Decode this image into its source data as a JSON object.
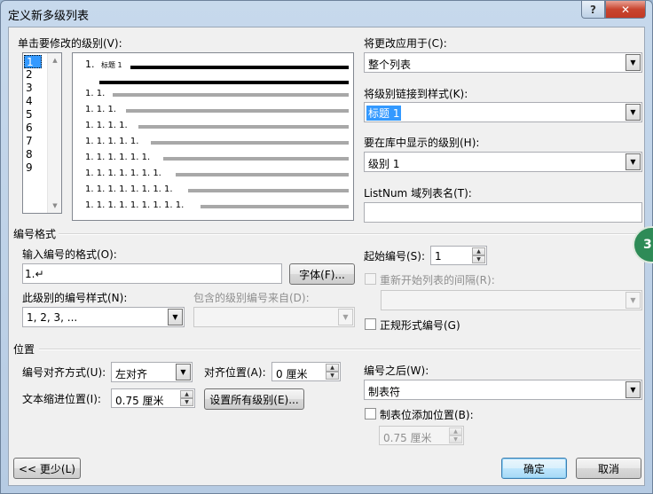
{
  "window": {
    "title": "定义新多级列表",
    "help_glyph": "?",
    "close_glyph": "✕"
  },
  "levels": {
    "label": "单击要修改的级别(V):",
    "items": [
      "1",
      "2",
      "3",
      "4",
      "5",
      "6",
      "7",
      "8",
      "9"
    ],
    "selected": "1"
  },
  "preview": {
    "first_number": "1.",
    "first_text": "标题 1",
    "rows": [
      "1. 1.",
      "1. 1. 1.",
      "1. 1. 1. 1.",
      "1. 1. 1. 1. 1.",
      "1. 1. 1. 1. 1. 1.",
      "1. 1. 1. 1. 1. 1. 1.",
      "1. 1. 1. 1. 1. 1. 1. 1.",
      "1. 1. 1. 1. 1. 1. 1. 1. 1."
    ]
  },
  "apply_to": {
    "label": "将更改应用于(C):",
    "value": "整个列表"
  },
  "link_style": {
    "label": "将级别链接到样式(K):",
    "value": "标题 1"
  },
  "gallery_level": {
    "label": "要在库中显示的级别(H):",
    "value": "级别 1"
  },
  "listnum": {
    "label": "ListNum 域列表名(T):",
    "value": ""
  },
  "number_format": {
    "section": "编号格式",
    "format_label": "输入编号的格式(O):",
    "format_value": "1.↵",
    "font_button": "字体(F)...",
    "style_label": "此级别的编号样式(N):",
    "style_value": "1, 2, 3, ...",
    "include_label": "包含的级别编号来自(D):",
    "include_value": "",
    "start_label": "起始编号(S):",
    "start_value": "1",
    "restart_label": "重新开始列表的间隔(R):",
    "restart_value": "",
    "legal_label": "正规形式编号(G)"
  },
  "position": {
    "section": "位置",
    "align_label": "编号对齐方式(U):",
    "align_value": "左对齐",
    "align_at_label": "对齐位置(A):",
    "align_at_value": "0 厘米",
    "indent_label": "文本缩进位置(I):",
    "indent_value": "0.75 厘米",
    "set_all_button": "设置所有级别(E)...",
    "follow_label": "编号之后(W):",
    "follow_value": "制表符",
    "tab_stop_label": "制表位添加位置(B):",
    "tab_stop_value": "0.75 厘米"
  },
  "buttons": {
    "less": "<< 更少(L)",
    "ok": "确定",
    "cancel": "取消"
  },
  "badge": {
    "text": "3"
  }
}
